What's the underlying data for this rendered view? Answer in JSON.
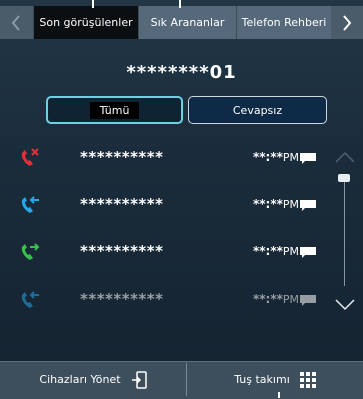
{
  "tabs": [
    {
      "label": "Son görüşülenler",
      "active": true
    },
    {
      "label": "Sık Arananlar",
      "active": false
    },
    {
      "label": "Telefon Rehberi",
      "active": false
    }
  ],
  "number": "********01",
  "filters": {
    "all": "Tümü",
    "missed": "Cevapsız"
  },
  "calls": [
    {
      "type": "missed",
      "name": "**********",
      "time": "**:**",
      "ampm": "PM",
      "icon": "missed-call-icon",
      "color": "#e0303a"
    },
    {
      "type": "incoming",
      "name": "**********",
      "time": "**:**",
      "ampm": "PM",
      "icon": "incoming-call-icon",
      "color": "#27a7e8"
    },
    {
      "type": "outgoing",
      "name": "**********",
      "time": "**:**",
      "ampm": "PM",
      "icon": "outgoing-call-icon",
      "color": "#38c04a"
    },
    {
      "type": "incoming",
      "name": "**********",
      "time": "**:**",
      "ampm": "PM",
      "icon": "incoming-call-icon",
      "color": "#27a7e8"
    }
  ],
  "bottom": {
    "manage_devices": "Cihazları Yönet",
    "keypad": "Tuş takımı"
  },
  "colors": {
    "accent": "#6fd0e2",
    "missed": "#e0303a",
    "incoming": "#27a7e8",
    "outgoing": "#38c04a"
  }
}
